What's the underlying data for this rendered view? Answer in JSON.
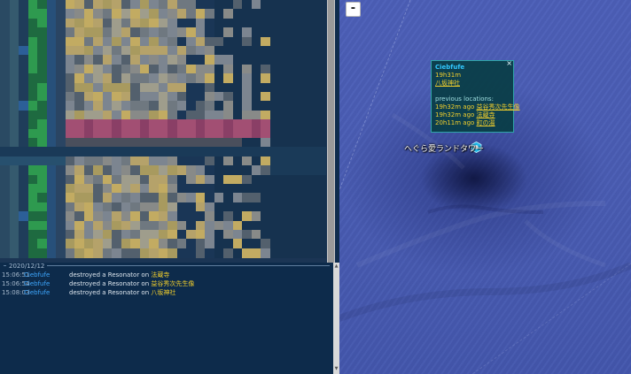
{
  "log": {
    "date": "2020/12/12",
    "entries": [
      {
        "time": "15:06:51",
        "agent": "Ciebfufe",
        "action": "destroyed a Resonator on",
        "portal": "法蔵寺"
      },
      {
        "time": "15:06:54",
        "agent": "Ciebfufe",
        "action": "destroyed a Resonator on",
        "portal": "益谷秀次先生像"
      },
      {
        "time": "15:08:03",
        "agent": "Ciebfufe",
        "action": "destroyed a Resonator on",
        "portal": "八坂神社"
      }
    ]
  },
  "map": {
    "zoom_out_label": "-",
    "portal_label": "へぐら愛ランドタワー",
    "popup": {
      "close_label": "×",
      "agent": "Ciebfufe",
      "duration": "19h31m",
      "portal": "八坂神社",
      "previous_label": "previous locations:",
      "previous": [
        {
          "time": "19h32m ago",
          "place": "益谷秀次先生像"
        },
        {
          "time": "19h32m ago",
          "place": "法蔵寺"
        },
        {
          "time": "20h11m ago",
          "place": "町の湯"
        }
      ]
    }
  },
  "colors": {
    "agent_blue": "#3ea8ff",
    "portal_yellow": "#f2cf2c",
    "popup_bg": "#093d46",
    "map_water": "#4a5db4"
  }
}
